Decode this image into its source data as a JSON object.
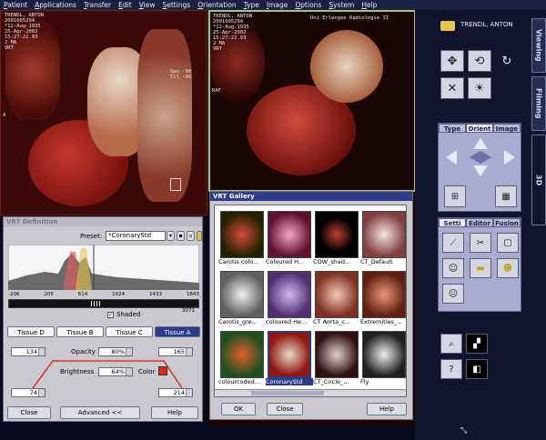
{
  "menu": [
    "Patient",
    "Applications",
    "Transfer",
    "Edit",
    "View",
    "Settings",
    "Orientation",
    "Type",
    "Image",
    "Options",
    "System",
    "Help"
  ],
  "viewport_left": {
    "patient_info": "TRENDL, ANTON\n2001605294\n*12-Aug-1935\n25-Apr-2002\n15:27:22.93\n2 MA\nVRT",
    "angle_text": "Spn -90\nTil -90",
    "side_marker": "A"
  },
  "viewport_right": {
    "patient_info": "TRENDL, ANTON\n2001605294\n*12-Aug-1935\n25-Apr-2002\n15:27:22.93\n2 MA\nVRT",
    "institution": "Uni Erlangen Radiologie II",
    "orientation_marker": "RAF"
  },
  "vrt_definition": {
    "title": "VRT Definition",
    "preset_label": "Preset:",
    "preset_value": "*CoronaryStd",
    "axis_ticks": [
      "-206",
      "205",
      "614",
      "1024",
      "1433",
      "1843"
    ],
    "axis_min": "",
    "axis_max": "3071",
    "shaded_label": "Shaded",
    "tissues": [
      "Tissue D",
      "Tissue B",
      "Tissue C",
      "Tissue A"
    ],
    "opacity_label": "Opacity",
    "opacity_value": "80%",
    "brightness_label": "Brightness",
    "brightness_value": "64%",
    "color_label": "Color",
    "left_top_value": "134",
    "right_top_value": "165",
    "left_bottom_value": "74",
    "right_bottom_value": "214",
    "close_label": "Close",
    "advanced_label": "Advanced <<",
    "help_label": "Help"
  },
  "vrt_gallery": {
    "title": "VRT Gallery",
    "items": [
      "Carotis colo...",
      "Coloured H...",
      "COW_shad...",
      "CT_Default",
      "Carotis_gre...",
      "coloured He...",
      "CT Aorta_c...",
      "Extremities_...",
      "colourcoded...",
      "CoronaryStd",
      "CT_Circle_...",
      "Fly"
    ],
    "selected_index": 9,
    "ok_label": "OK",
    "close_label": "Close",
    "help_label": "Help"
  },
  "right_panel": {
    "patient_name": "TRENDL, ANTON",
    "vertical_tabs": [
      "Viewing",
      "Filming",
      "3D"
    ],
    "orient_tabs": [
      "Type",
      "Orient",
      "Image"
    ],
    "vrt_tabs": [
      "Setti",
      "Editor",
      "Fusion"
    ],
    "tool_icons": [
      "rotate-arrows-icon",
      "free-rotate-icon",
      "roll-icon",
      "cut-plane-icon",
      "light-icon"
    ]
  },
  "colors": {
    "accent_blue": "#2a3c8a",
    "color_swatch": "#d92a1c",
    "viewport_border": "#a6c47a"
  }
}
